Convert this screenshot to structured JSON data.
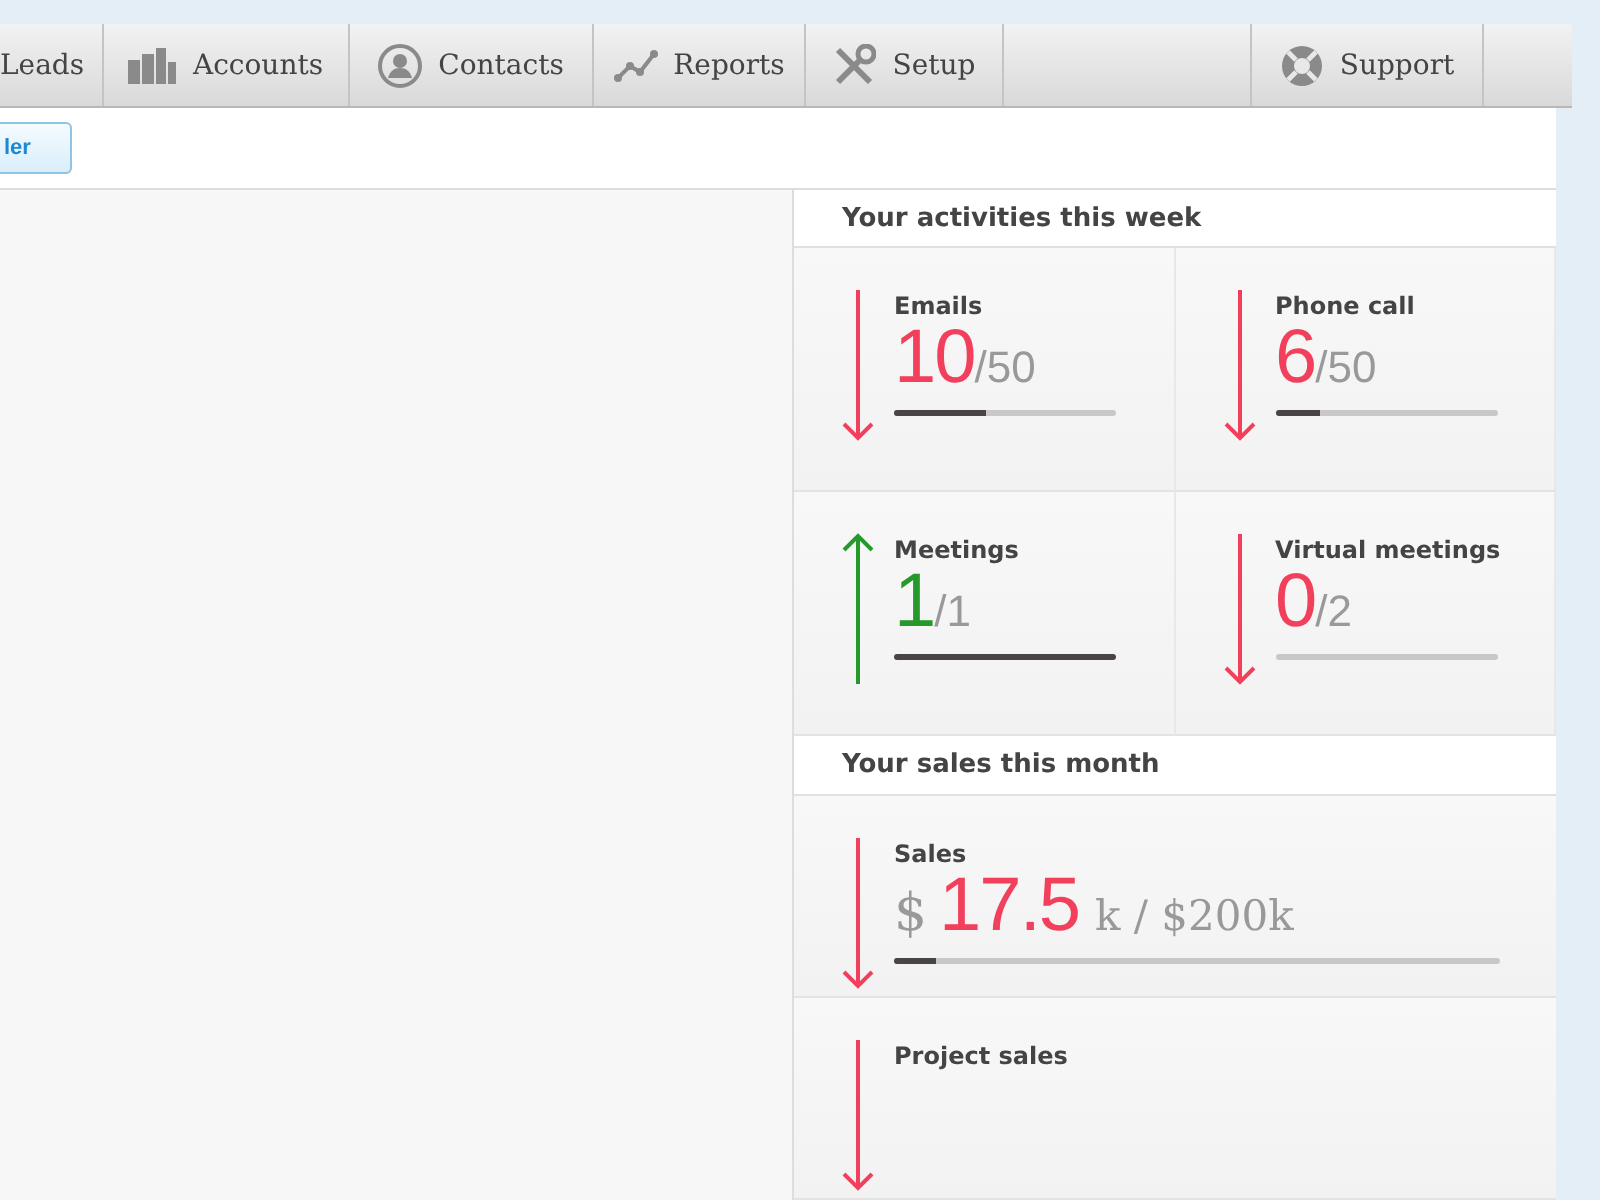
{
  "nav": {
    "items": [
      {
        "label": "Leads",
        "kind": "plain"
      },
      {
        "label": "Accounts",
        "kind": "buildings"
      },
      {
        "label": "Contacts",
        "kind": "person"
      },
      {
        "label": "Reports",
        "kind": "chart"
      },
      {
        "label": "Setup",
        "kind": "tools"
      }
    ],
    "support": {
      "label": "Support",
      "kind": "lifebuoy"
    }
  },
  "toolbar": {
    "button": "ler"
  },
  "activities": {
    "title": "Your activities this week",
    "metrics": [
      {
        "label": "Emails",
        "value": "10",
        "total": "/50",
        "kind": "falling",
        "level": 0.41
      },
      {
        "label": "Phone call",
        "value": "6",
        "total": "/50",
        "kind": "falling",
        "level": 0.2
      },
      {
        "label": "Meetings",
        "value": "1",
        "total": "/1",
        "kind": "rising",
        "level": 1
      },
      {
        "label": "Virtual meetings",
        "value": "0",
        "total": "/2",
        "kind": "falling",
        "level": 0
      }
    ]
  },
  "sales": {
    "title": "Your sales this month",
    "metrics": [
      {
        "label": "Sales",
        "prefix": "$",
        "value": "17.5",
        "suffix": "k / $200k",
        "kind": "falling",
        "level": 0.07
      },
      {
        "label": "Project sales",
        "kind": "falling"
      }
    ]
  }
}
